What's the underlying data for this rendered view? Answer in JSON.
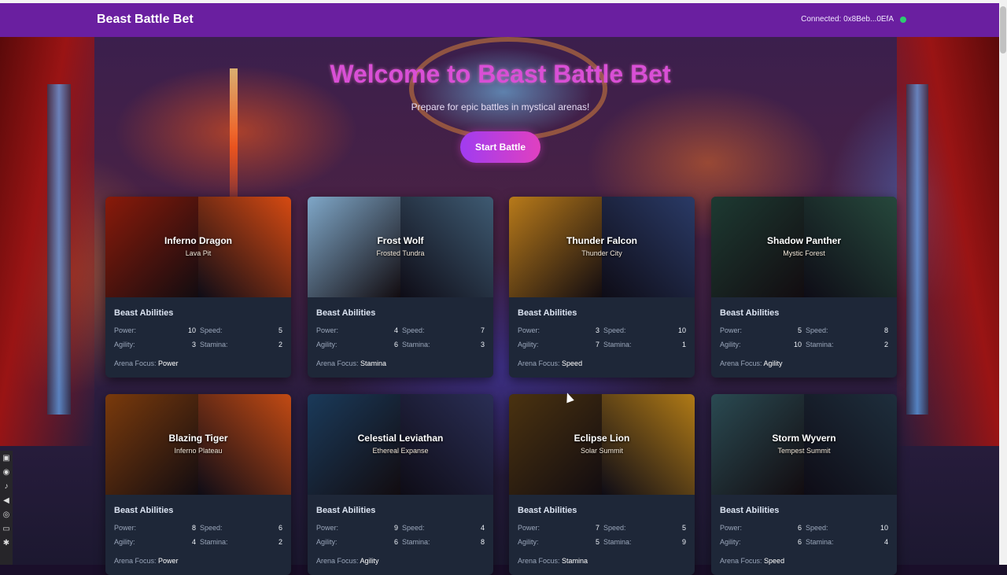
{
  "app": {
    "brand": "Beast Battle Bet",
    "wallet_text": "Connected: 0x8Beb...0EfA",
    "status_color": "#2ecc71"
  },
  "hero": {
    "title": "Welcome to Beast Battle Bet",
    "subtitle": "Prepare for epic battles in mystical arenas!",
    "start_button": "Start Battle"
  },
  "labels": {
    "abilities": "Beast Abilities",
    "power": "Power:",
    "speed": "Speed:",
    "agility": "Agility:",
    "stamina": "Stamina:",
    "arena_focus": "Arena Focus:"
  },
  "beasts": [
    {
      "name": "Inferno Dragon",
      "arena": "Lava Pit",
      "power": "10",
      "speed": "5",
      "agility": "3",
      "stamina": "2",
      "focus": "Power",
      "colors": [
        "#8a1a0a",
        "#d64a12"
      ]
    },
    {
      "name": "Frost Wolf",
      "arena": "Frosted Tundra",
      "power": "4",
      "speed": "7",
      "agility": "6",
      "stamina": "3",
      "focus": "Stamina",
      "colors": [
        "#7fa7c8",
        "#3e5a72"
      ]
    },
    {
      "name": "Thunder Falcon",
      "arena": "Thunder City",
      "power": "3",
      "speed": "10",
      "agility": "7",
      "stamina": "1",
      "focus": "Speed",
      "colors": [
        "#b87a1a",
        "#2a3a66"
      ]
    },
    {
      "name": "Shadow Panther",
      "arena": "Mystic Forest",
      "power": "5",
      "speed": "8",
      "agility": "10",
      "stamina": "2",
      "focus": "Agility",
      "colors": [
        "#1d3a32",
        "#26483c"
      ]
    },
    {
      "name": "Blazing Tiger",
      "arena": "Inferno Plateau",
      "power": "8",
      "speed": "6",
      "agility": "4",
      "stamina": "2",
      "focus": "Power",
      "colors": [
        "#7a3a0c",
        "#c24a14"
      ]
    },
    {
      "name": "Celestial Leviathan",
      "arena": "Ethereal Expanse",
      "power": "9",
      "speed": "4",
      "agility": "6",
      "stamina": "8",
      "focus": "Agility",
      "colors": [
        "#1a3a5a",
        "#2a2e55"
      ]
    },
    {
      "name": "Eclipse Lion",
      "arena": "Solar Summit",
      "power": "7",
      "speed": "5",
      "agility": "5",
      "stamina": "9",
      "focus": "Stamina",
      "colors": [
        "#4a3210",
        "#b07a16"
      ]
    },
    {
      "name": "Storm Wyvern",
      "arena": "Tempest Summit",
      "power": "6",
      "speed": "10",
      "agility": "6",
      "stamina": "4",
      "focus": "Speed",
      "colors": [
        "#2a4a52",
        "#1e2e3c"
      ]
    }
  ],
  "tool_icons": [
    "camera-icon",
    "record-icon",
    "mic-icon",
    "speaker-icon",
    "target-icon",
    "screen-icon",
    "settings-icon"
  ]
}
